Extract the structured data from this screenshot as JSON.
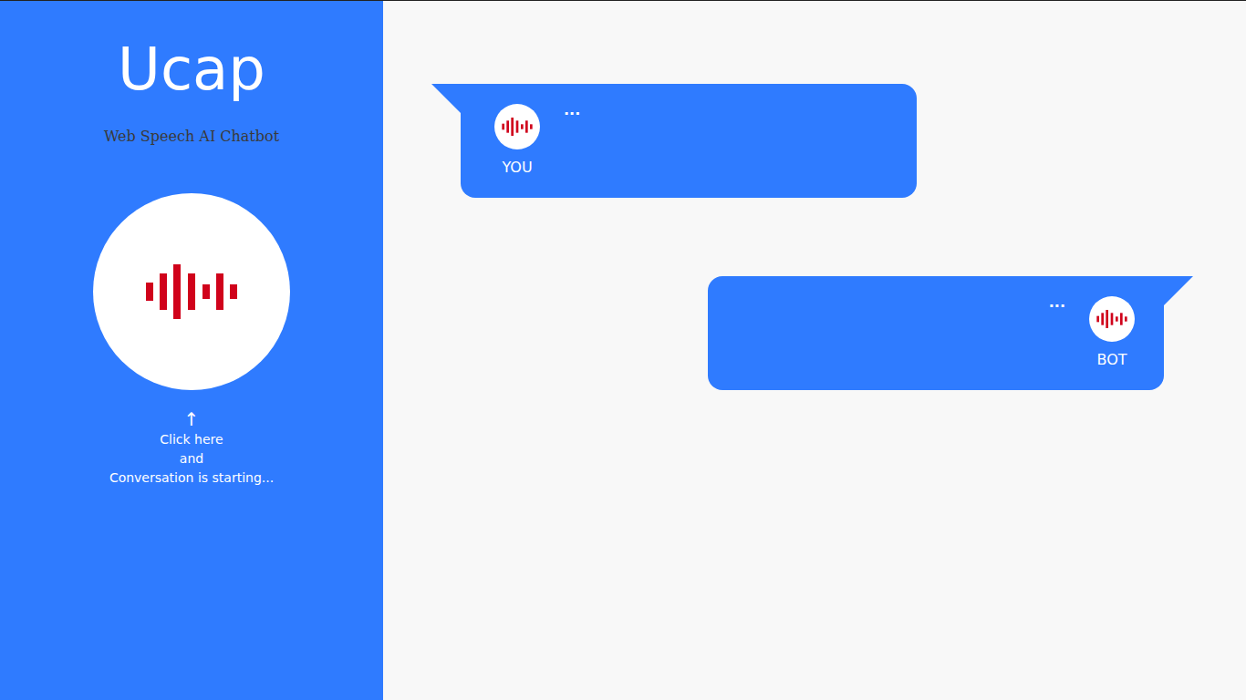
{
  "sidebar": {
    "title": "Ucap",
    "subtitle": "Web Speech AI Chatbot",
    "arrow": "↑",
    "hint": [
      "Click here",
      "and",
      "Conversation is starting..."
    ]
  },
  "messages": [
    {
      "speaker": "YOU",
      "text": "...",
      "kind": "user"
    },
    {
      "speaker": "BOT",
      "text": "...",
      "kind": "bot"
    }
  ]
}
